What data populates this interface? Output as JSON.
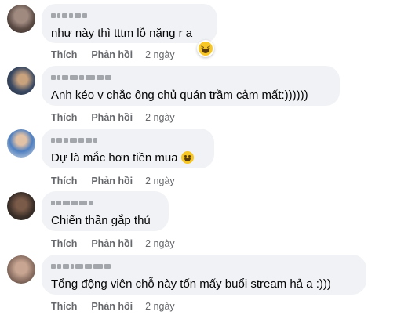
{
  "comments": [
    {
      "text": "như này thì tttm lỗ nặng r a",
      "like": "Thích",
      "reply": "Phản hồi",
      "time": "2 ngày",
      "avatar_color": "#6b5a52",
      "reaction": "laughing-emoji"
    },
    {
      "text": "Anh kéo v chắc ông chủ quán trầm cảm mất:))))))",
      "like": "Thích",
      "reply": "Phản hồi",
      "time": "2 ngày",
      "avatar_color": "#3b4a63"
    },
    {
      "text": "Dự là mắc hơn tiền mua",
      "like": "Thích",
      "reply": "Phản hồi",
      "time": "2 ngày",
      "avatar_color": "#4f7fc0",
      "emoji": "smiling-emoji"
    },
    {
      "text": "Chiến thần gắp thú",
      "like": "Thích",
      "reply": "Phản hồi",
      "time": "2 ngày",
      "avatar_color": "#4a3a33"
    },
    {
      "text": "Tổng động viên chỗ này tốn mấy buổi stream hả a :)))",
      "like": "Thích",
      "reply": "Phản hồi",
      "time": "2 ngày",
      "avatar_color": "#8a6f62"
    }
  ]
}
